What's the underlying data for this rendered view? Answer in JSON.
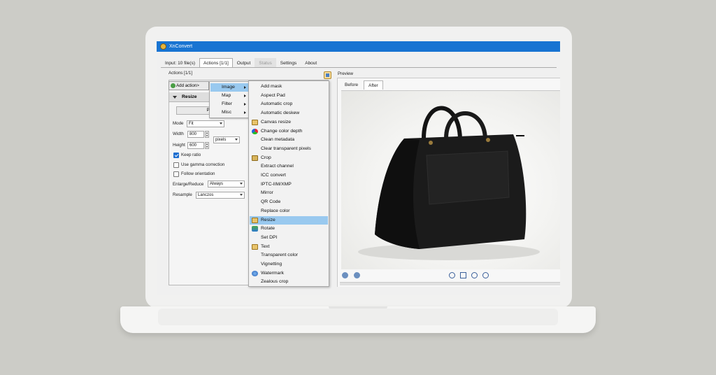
{
  "window": {
    "title": "XnConvert"
  },
  "tabs": [
    {
      "label": "Input: 10 file(s)"
    },
    {
      "label": "Actions [1/1]"
    },
    {
      "label": "Output"
    },
    {
      "label": "Status"
    },
    {
      "label": "Settings"
    },
    {
      "label": "About"
    }
  ],
  "actions": {
    "group_label": "Actions [1/1]",
    "add_action_label": "Add action>",
    "resize_header": "Resize",
    "presets_label": "Pres",
    "mode": {
      "label": "Mode",
      "value": "Fit"
    },
    "width": {
      "label": "Width",
      "value": "800"
    },
    "height": {
      "label": "Height",
      "value": "600"
    },
    "unit": {
      "value": "pixels"
    },
    "keep_ratio": {
      "label": "Keep ratio",
      "checked": true
    },
    "gamma": {
      "label": "Use gamma correction",
      "checked": false
    },
    "orientation": {
      "label": "Follow orientation",
      "checked": false
    },
    "enlarge": {
      "label": "Enlarge/Reduce",
      "value": "Always"
    },
    "resample": {
      "label": "Resample",
      "value": "Lanczos"
    }
  },
  "menu_categories": [
    {
      "label": "Image",
      "highlighted": true
    },
    {
      "label": "Map"
    },
    {
      "label": "Filter"
    },
    {
      "label": "Misc"
    }
  ],
  "image_submenu": [
    {
      "label": "Add mask"
    },
    {
      "label": "Aspect Pad"
    },
    {
      "label": "Automatic crop"
    },
    {
      "label": "Automatic deskew"
    },
    {
      "label": "Canvas resize",
      "icon": "canvas-resize-icon"
    },
    {
      "label": "Change color depth",
      "icon": "color-depth-icon"
    },
    {
      "label": "Clean metadata"
    },
    {
      "label": "Clear transparent pixels"
    },
    {
      "label": "Crop",
      "icon": "crop-icon"
    },
    {
      "label": "Extract channel"
    },
    {
      "label": "ICC convert"
    },
    {
      "label": "IPTC-IIM/XMP"
    },
    {
      "label": "Mirror"
    },
    {
      "label": "QR Code"
    },
    {
      "label": "Replace color"
    },
    {
      "label": "Resize",
      "icon": "resize-icon",
      "highlighted": true
    },
    {
      "label": "Rotate",
      "icon": "rotate-icon"
    },
    {
      "label": "Set DPI"
    },
    {
      "label": "Text",
      "icon": "text-icon"
    },
    {
      "label": "Transparent color"
    },
    {
      "label": "Vignetting"
    },
    {
      "label": "Watermark",
      "icon": "watermark-icon"
    },
    {
      "label": "Zealous crop"
    }
  ],
  "preview": {
    "label": "Preview",
    "tabs": [
      {
        "label": "Before"
      },
      {
        "label": "After"
      }
    ]
  },
  "colors": {
    "titlebar": "#1874d2",
    "highlight": "#99c9ef",
    "background": "#ccccc7"
  }
}
